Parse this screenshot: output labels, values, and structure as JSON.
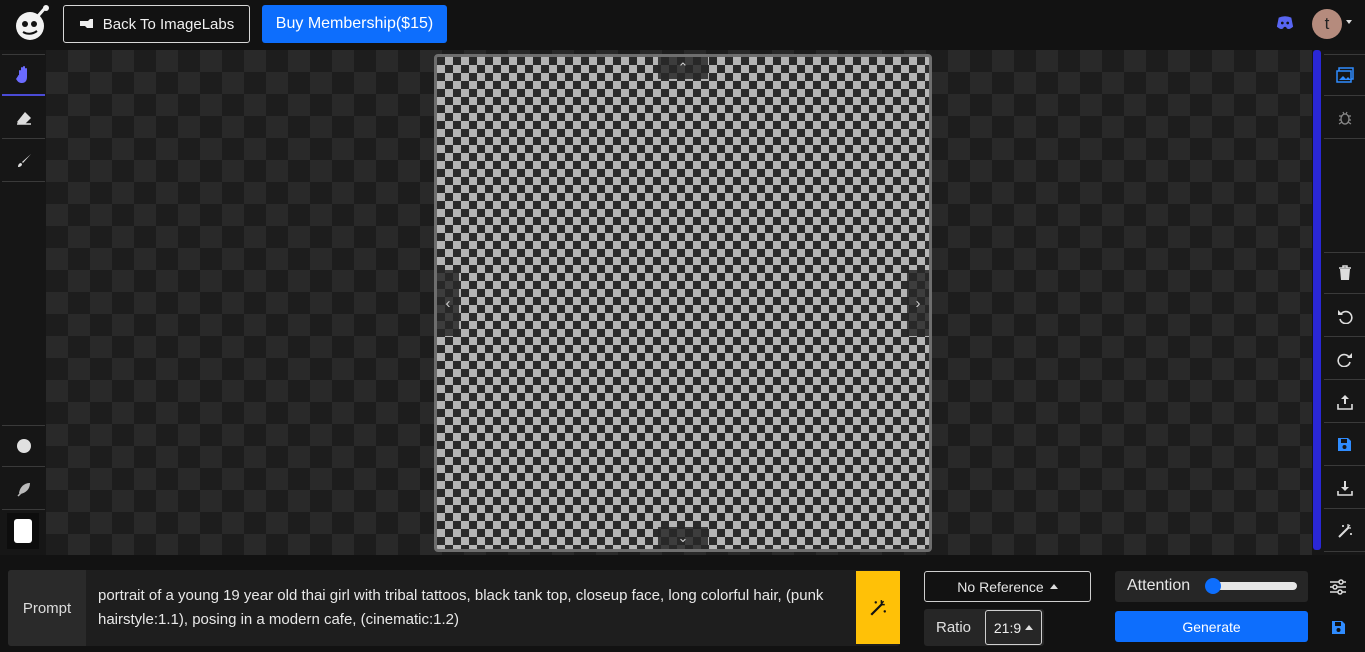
{
  "header": {
    "back_label": "Back To ImageLabs",
    "buy_label": "Buy Membership($15)",
    "avatar_letter": "t"
  },
  "left_tools": [
    {
      "name": "hand-icon",
      "active": true
    },
    {
      "name": "eraser-icon",
      "active": false
    },
    {
      "name": "brush-icon",
      "active": false
    },
    {
      "name": "circle-icon",
      "active": false
    },
    {
      "name": "feather-icon",
      "active": false
    }
  ],
  "right_tools": [
    "image-icon",
    "bug-icon",
    "trash-icon",
    "undo-icon",
    "redo-icon",
    "upload-icon",
    "save-icon",
    "download-icon",
    "magic-wand-icon"
  ],
  "bottom": {
    "prompt_label": "Prompt",
    "prompt_text": "portrait of a young 19 year old thai girl with tribal tattoos, black tank top, closeup face, long colorful hair, (punk hairstyle:1.1), posing in a modern cafe, (cinematic:1.2)",
    "reference_label": "No Reference",
    "ratio_label": "Ratio",
    "ratio_value": "21:9",
    "attention_label": "Attention",
    "attention_level": 0.05,
    "generate_label": "Generate"
  },
  "colors": {
    "accent": "#0d6efd",
    "indigo": "#4b4bd6",
    "magic": "#ffc107"
  }
}
